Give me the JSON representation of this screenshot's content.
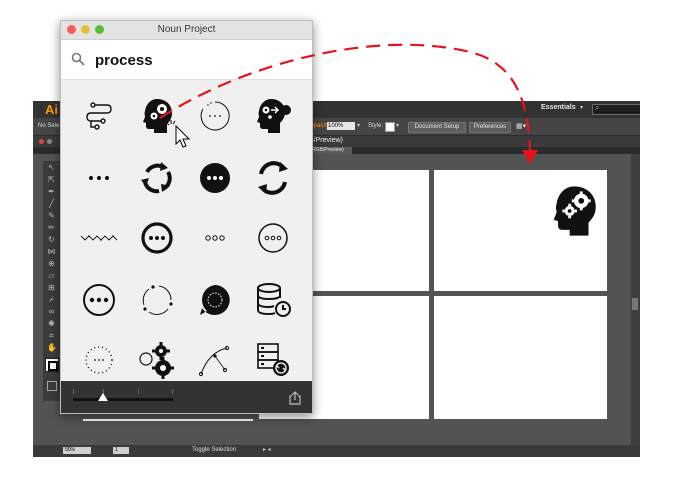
{
  "illustrator": {
    "logo": "Ai",
    "workspace": "Essentials",
    "control_bar": {
      "no_selection": "No Sele",
      "opacity_label": "Opacity:",
      "opacity_value": "100%",
      "style_label": "Style:",
      "document_setup_label": "Document Setup",
      "preferences_label": "Preferences"
    },
    "document_title": "-3 @ 50% (RGB/Preview)",
    "document_tab": "RGB/Preview)",
    "status_bar": {
      "zoom": "50%",
      "page": "1",
      "status_text": "Toggle Selection"
    },
    "colors": {
      "accent": "#ff9a00",
      "canvas": "#535353",
      "chrome": "#323232"
    }
  },
  "noun_project": {
    "window_title": "Noun Project",
    "search": {
      "value": "process",
      "placeholder": ""
    },
    "traffic_lights": [
      "#fc5b57",
      "#e5bf3c",
      "#57c038"
    ],
    "icons": [
      [
        "process-flow-icon",
        "head-gears-icon",
        "dotted-circle-progress-icon",
        "head-gears-arrow-icon"
      ],
      [
        "ellipsis-icon",
        "cycle-arrows-icon",
        "ellipsis-circle-filled-icon",
        "refresh-circle-icon"
      ],
      [
        "zigzag-line-icon",
        "ellipsis-circle-bold-icon",
        "three-dots-icon",
        "ellipsis-circle-outline-icon"
      ],
      [
        "ellipsis-circle-icon",
        "dotted-cycle-icon",
        "chat-loading-icon",
        "database-clock-icon"
      ],
      [
        "dotted-circle-icon",
        "gears-icon",
        "bezier-path-icon",
        "server-sync-icon"
      ]
    ],
    "footer": {
      "share_icon": "share-icon"
    }
  },
  "drag_annotation": {
    "color": "#e8121c"
  }
}
